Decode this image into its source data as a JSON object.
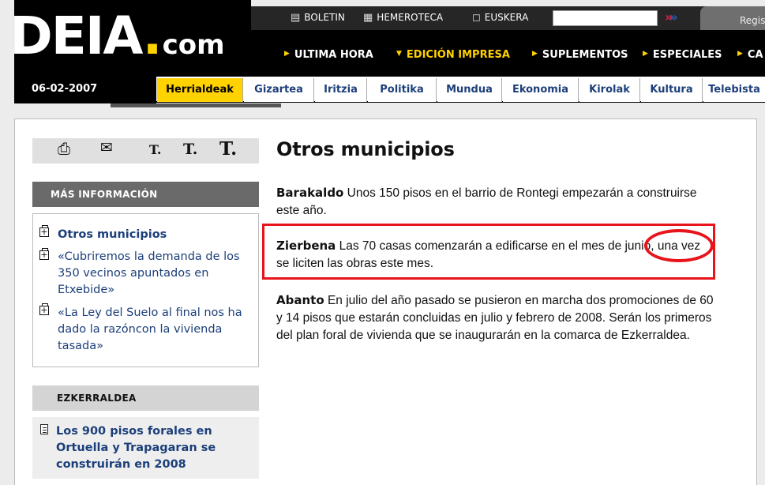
{
  "header": {
    "logo_text": "DEIA",
    "logo_dot": ".",
    "logo_suffix": "com",
    "top_links": [
      {
        "label": "BOLETIN",
        "icon": "printer-icon"
      },
      {
        "label": "HEMEROTECA",
        "icon": "archive-icon"
      },
      {
        "label": "EUSKERA",
        "icon": "speech-bubble-icon"
      }
    ],
    "search_value": "",
    "register_label": "Regis",
    "main_nav": [
      "ULTIMA HORA",
      "EDICIÓN IMPRESA",
      "SUPLEMENTOS",
      "ESPECIALES",
      "CA"
    ],
    "date": "06-02-2007",
    "categories": [
      "Herrialdeak",
      "Gizartea",
      "Iritzia",
      "Politika",
      "Mundua",
      "Ekonomia",
      "Kirolak",
      "Kultura",
      "Telebista"
    ]
  },
  "tools": {
    "print_icon": "printer-icon",
    "email_icon": "envelope-icon",
    "font_sizes": [
      "T",
      "T",
      "T"
    ]
  },
  "sidebar": {
    "more_info_title": "MÁS INFORMACIÓN",
    "more_info_links": [
      "Otros municipios",
      "«Cubriremos la demanda de los 350 vecinos apuntados en Etxebide»",
      "«La Ley del Suelo al final nos ha dado la razóncon la vivienda tasada»"
    ],
    "ezkerraldea_title": "EZKERRALDEA",
    "ezkerraldea_link": "Los 900 pisos forales en Ortuella y Trapagaran se construirán en 2008"
  },
  "article": {
    "title": "Otros municipios",
    "items": [
      {
        "place": "Barakaldo",
        "text": "Unos 150 pisos en el barrio de Rontegi empezarán a construirse este año."
      },
      {
        "place": "Zierbena",
        "text": "Las 70 casas comenzarán a edificarse en el mes de junio, una vez se liciten las obras este mes."
      },
      {
        "place": "Abanto",
        "text": "En julio del año pasado se pusieron en marcha dos promociones de 60 y 14 pisos que estarán concluidas en julio y febrero de 2008. Serán los primeros del plan foral de vivienda que se inaugurarán en la comarca de Ezkerraldea."
      }
    ]
  },
  "colors": {
    "accent": "#ffd200",
    "link": "#1c3f7a",
    "annotation": "#e8141b"
  }
}
